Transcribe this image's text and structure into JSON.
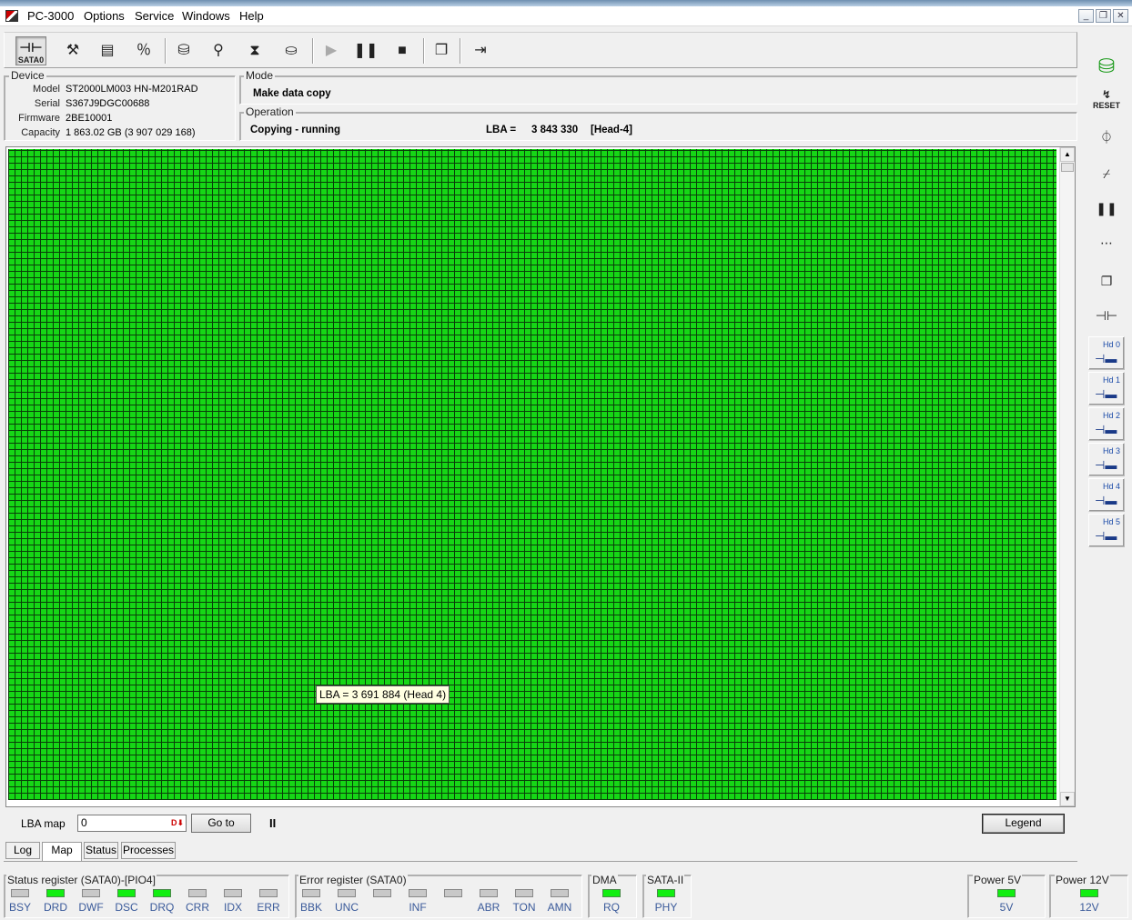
{
  "app": {
    "title": "PC-3000"
  },
  "menu": [
    "Options",
    "Service",
    "Windows",
    "Help"
  ],
  "window_buttons": [
    "_",
    "❐",
    "✕"
  ],
  "toolbar": {
    "sata_label": "SATA0"
  },
  "device": {
    "legend": "Device",
    "rows": [
      {
        "key": "Model",
        "value": "ST2000LM003 HN-M201RAD"
      },
      {
        "key": "Serial",
        "value": "S367J9DGC00688"
      },
      {
        "key": "Firmware",
        "value": "2BE10001"
      },
      {
        "key": "Capacity",
        "value": "1 863.02 GB (3 907 029 168)"
      }
    ]
  },
  "mode": {
    "legend": "Mode",
    "value": "Make data copy"
  },
  "operation": {
    "legend": "Operation",
    "status": "Copying - running",
    "lba_label": "LBA =",
    "lba_value": "3 843 330",
    "head": "[Head-4]"
  },
  "map": {
    "tooltip": "LBA =  3 691 884 (Head 4)",
    "cell_color": "#16d616"
  },
  "controls": {
    "lba_label": "LBA map",
    "lba_input": "0",
    "goto_label": "Go to",
    "pause_glyph": "II",
    "legend_label": "Legend"
  },
  "tabs": [
    "Log",
    "Map",
    "Status",
    "Processes"
  ],
  "status_register": {
    "title": "Status register (SATA0)-[PIO4]",
    "bits": [
      {
        "label": "BSY",
        "on": false
      },
      {
        "label": "DRD",
        "on": true
      },
      {
        "label": "DWF",
        "on": false
      },
      {
        "label": "DSC",
        "on": true
      },
      {
        "label": "DRQ",
        "on": true
      },
      {
        "label": "CRR",
        "on": false
      },
      {
        "label": "IDX",
        "on": false
      },
      {
        "label": "ERR",
        "on": false
      }
    ]
  },
  "error_register": {
    "title": "Error register (SATA0)",
    "bits": [
      {
        "label": "BBK",
        "on": false
      },
      {
        "label": "UNC",
        "on": false
      },
      {
        "label": "",
        "on": false
      },
      {
        "label": "INF",
        "on": false
      },
      {
        "label": "",
        "on": false
      },
      {
        "label": "ABR",
        "on": false
      },
      {
        "label": "TON",
        "on": false
      },
      {
        "label": "AMN",
        "on": false
      }
    ]
  },
  "dma": {
    "title": "DMA",
    "label": "RQ",
    "on": true
  },
  "sata2": {
    "title": "SATA-II",
    "label": "PHY",
    "on": true
  },
  "power5": {
    "title": "Power 5V",
    "label": "5V",
    "on": true
  },
  "power12": {
    "title": "Power 12V",
    "label": "12V",
    "on": true
  },
  "right_tools": {
    "reset_label": "RESET",
    "heads": [
      "Hd 0",
      "Hd 1",
      "Hd 2",
      "Hd 3",
      "Hd 4",
      "Hd 5"
    ]
  },
  "colors": {
    "led_on": "#11ee11",
    "led_off": "#c8c8c8",
    "map_green": "#16d616"
  }
}
